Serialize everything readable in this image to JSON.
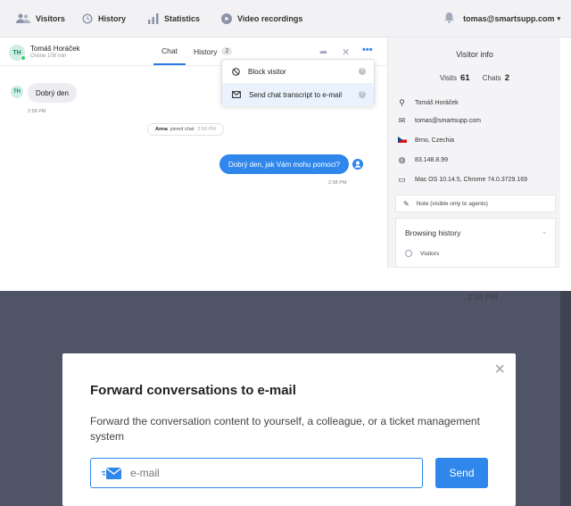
{
  "topbar": {
    "nav": [
      {
        "label": "Visitors",
        "icon": "visitors-icon"
      },
      {
        "label": "History",
        "icon": "history-icon"
      },
      {
        "label": "Statistics",
        "icon": "statistics-icon"
      },
      {
        "label": "Video recordings",
        "icon": "video-icon"
      }
    ],
    "user_email": "tomas@smartsupp.com"
  },
  "chat_header": {
    "avatar_initials": "TH",
    "visitor_name": "Tomáš Horáček",
    "visitor_status": "Online 108 min",
    "tabs": [
      {
        "label": "Chat"
      },
      {
        "label": "History",
        "badge": "2"
      }
    ]
  },
  "dropdown": {
    "items": [
      {
        "label": "Block visitor",
        "icon": "block-icon"
      },
      {
        "label": "Send chat transcript to e-mail",
        "icon": "envelope-icon"
      }
    ]
  },
  "messages": {
    "incoming": {
      "avatar": "TH",
      "text": "Dobrý den",
      "time": "2:58 PM"
    },
    "system": {
      "agent": "Anna",
      "text": "joined chat",
      "time": "2:58 PM"
    },
    "outgoing": {
      "text": "Dobrý den, jak Vám mohu pomoci?",
      "time": "2:58 PM"
    }
  },
  "sidebar": {
    "title": "Visitor info",
    "visits_label": "Visits",
    "visits": "61",
    "chats_label": "Chats",
    "chats": "2",
    "rows": [
      {
        "icon": "person-icon",
        "text": "Tomáš Horáček"
      },
      {
        "icon": "envelope-icon",
        "text": "tomas@smartsupp.com"
      },
      {
        "icon": "flag-cz-icon",
        "text": "Brno, Czechia"
      },
      {
        "icon": "globe-icon",
        "text": "83.148.8.99"
      },
      {
        "icon": "monitor-icon",
        "text": "Mac OS 10.14.5, Chrome 74.0.3729.169"
      }
    ],
    "note": "Note (visible only to agents)",
    "browsing_history_title": "Browsing history",
    "browsing_history_item": "Visitors"
  },
  "modal_background": {
    "time": "2:58 PM"
  },
  "modal": {
    "title": "Forward conversations to e-mail",
    "description": "Forward the conversation content to yourself, a colleague, or a ticket management system",
    "email_placeholder": "e-mail",
    "send_label": "Send"
  },
  "colors": {
    "accent": "#2f86eb",
    "overlay": "#4f5566",
    "online": "#2ecc71"
  }
}
